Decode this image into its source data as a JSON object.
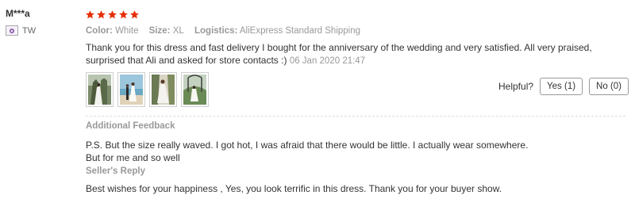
{
  "review": {
    "user_name": "M***a",
    "country": "TW",
    "rating": 5,
    "star_color": "#e62e04",
    "meta": {
      "color_label": "Color:",
      "color_value": "White",
      "size_label": "Size:",
      "size_value": "XL",
      "logistics_label": "Logistics:",
      "logistics_value": "AliExpress Standard Shipping"
    },
    "content": "Thank you for this dress and fast delivery I bought for the anniversary of the wedding and very satisfied. All very praised, surprised that Ali and asked for store contacts :)",
    "date": "06 Jan 2020 21:47",
    "photos": [
      {
        "alt": "wedding photo 1"
      },
      {
        "alt": "wedding photo 2"
      },
      {
        "alt": "wedding photo 3"
      },
      {
        "alt": "wedding photo 4"
      }
    ],
    "helpful": {
      "label": "Helpful?",
      "yes_label": "Yes (1)",
      "no_label": "No (0)"
    },
    "additional_feedback": {
      "title": "Additional Feedback",
      "text": "P.S. But the size really waved. I got hot, I was afraid that there would be little. I actually wear somewhere. But for me and so well"
    },
    "seller_reply": {
      "title": "Seller's Reply",
      "text": "Best wishes for your happiness , Yes, you look terrific in this dress. Thank you for your buyer show."
    }
  }
}
